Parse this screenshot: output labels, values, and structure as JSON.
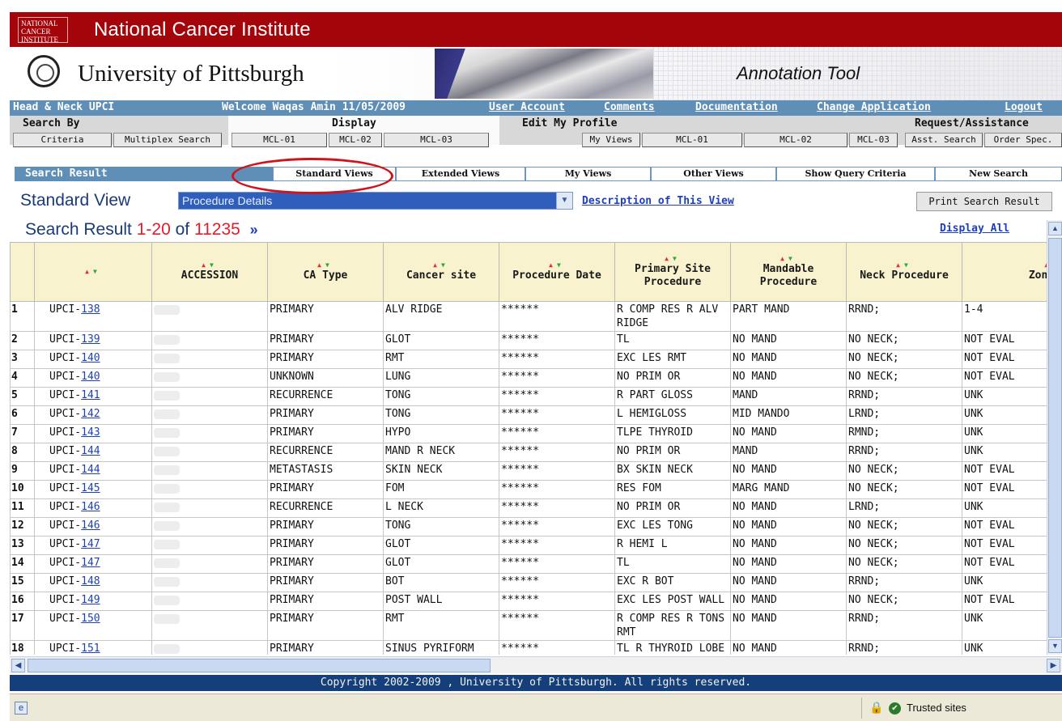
{
  "nci_banner": {
    "logo_text": "NATIONAL CANCER INSTITUTE",
    "title": "National Cancer Institute"
  },
  "pitt_header": {
    "university": "University of Pittsburgh",
    "tool_name": "Annotation Tool"
  },
  "navbar": {
    "section": "Head & Neck  UPCI",
    "welcome": "Welcome Waqas Amin 11/05/2009",
    "links": [
      "User Account",
      "Comments",
      "Documentation",
      "Change Application",
      "Logout"
    ]
  },
  "groups": {
    "search_by": {
      "label": "Search By",
      "buttons": [
        "Criteria",
        "Multiplex Search"
      ]
    },
    "display": {
      "label": "Display",
      "buttons": [
        "MCL-01",
        "MCL-02",
        "MCL-03"
      ]
    },
    "edit_profile": {
      "label": "Edit My Profile",
      "buttons": [
        "My Views",
        "MCL-01",
        "MCL-02",
        "MCL-03"
      ]
    },
    "request": {
      "label": "Request/Assistance",
      "buttons": [
        "Asst. Search",
        "Order Spec."
      ]
    }
  },
  "tabs": {
    "result_label": "Search Result",
    "items": [
      "Standard Views",
      "Extended Views",
      "My Views",
      "Other Views",
      "Show Query Criteria",
      "New Search"
    ]
  },
  "standard_view": {
    "label": "Standard View",
    "selected": "Procedure Details",
    "description_link": "Description of This View",
    "print_button": "Print Search Result"
  },
  "search_result": {
    "prefix": "Search Result",
    "range": "1-20",
    "of": "of",
    "total": "11235",
    "next_icon": "»",
    "display_all": "Display All"
  },
  "table": {
    "columns": [
      "",
      "",
      "ACCESSION",
      "CA Type",
      "Cancer site",
      "Procedure Date",
      "Primary Site Procedure",
      "Mandable Procedure",
      "Neck Procedure",
      "Zones"
    ],
    "sort_arrows": "▲▼",
    "rows": [
      {
        "n": "1",
        "prefix": "UPCI-",
        "id": "138",
        "ca": "PRIMARY",
        "site": "ALV RIDGE",
        "date": "******",
        "psp": "R COMP RES R ALV RIDGE",
        "mand": "PART MAND",
        "neck": "RRND;",
        "zones": "1-4"
      },
      {
        "n": "2",
        "prefix": "UPCI-",
        "id": "139",
        "ca": "PRIMARY",
        "site": "GLOT",
        "date": "******",
        "psp": "TL",
        "mand": "NO MAND",
        "neck": "NO NECK;",
        "zones": "NOT EVAL"
      },
      {
        "n": "3",
        "prefix": "UPCI-",
        "id": "140",
        "ca": "PRIMARY",
        "site": "RMT",
        "date": "******",
        "psp": "EXC LES RMT",
        "mand": "NO MAND",
        "neck": "NO NECK;",
        "zones": "NOT EVAL"
      },
      {
        "n": "4",
        "prefix": "UPCI-",
        "id": "140",
        "ca": "UNKNOWN",
        "site": "LUNG",
        "date": "******",
        "psp": "NO PRIM OR",
        "mand": "NO MAND",
        "neck": "NO NECK;",
        "zones": "NOT EVAL"
      },
      {
        "n": "5",
        "prefix": "UPCI-",
        "id": "141",
        "ca": "RECURRENCE",
        "site": "TONG",
        "date": "******",
        "psp": "R PART GLOSS",
        "mand": "MAND",
        "neck": "RRND;",
        "zones": "UNK"
      },
      {
        "n": "6",
        "prefix": "UPCI-",
        "id": "142",
        "ca": "PRIMARY",
        "site": "TONG",
        "date": "******",
        "psp": "L HEMIGLOSS",
        "mand": "MID MANDO",
        "neck": "LRND;",
        "zones": "UNK"
      },
      {
        "n": "7",
        "prefix": "UPCI-",
        "id": "143",
        "ca": "PRIMARY",
        "site": "HYPO",
        "date": "******",
        "psp": "TLPE THYROID",
        "mand": "NO MAND",
        "neck": "RMND;",
        "zones": "UNK"
      },
      {
        "n": "8",
        "prefix": "UPCI-",
        "id": "144",
        "ca": "RECURRENCE",
        "site": "MAND R NECK",
        "date": "******",
        "psp": "NO PRIM OR",
        "mand": "MAND",
        "neck": "RRND;",
        "zones": "UNK"
      },
      {
        "n": "9",
        "prefix": "UPCI-",
        "id": "144",
        "ca": "METASTASIS",
        "site": "SKIN NECK",
        "date": "******",
        "psp": "BX SKIN NECK",
        "mand": "NO MAND",
        "neck": "NO NECK;",
        "zones": "NOT EVAL"
      },
      {
        "n": "10",
        "prefix": "UPCI-",
        "id": "145",
        "ca": "PRIMARY",
        "site": "FOM",
        "date": "******",
        "psp": "RES FOM",
        "mand": "MARG MAND",
        "neck": "NO NECK;",
        "zones": "NOT EVAL"
      },
      {
        "n": "11",
        "prefix": "UPCI-",
        "id": "146",
        "ca": "RECURRENCE",
        "site": "L NECK",
        "date": "******",
        "psp": "NO PRIM OR",
        "mand": "NO MAND",
        "neck": "LRND;",
        "zones": "UNK"
      },
      {
        "n": "12",
        "prefix": "UPCI-",
        "id": "146",
        "ca": "PRIMARY",
        "site": "TONG",
        "date": "******",
        "psp": "EXC LES TONG",
        "mand": "NO MAND",
        "neck": "NO NECK;",
        "zones": "NOT EVAL"
      },
      {
        "n": "13",
        "prefix": "UPCI-",
        "id": "147",
        "ca": "PRIMARY",
        "site": "GLOT",
        "date": "******",
        "psp": "R HEMI L",
        "mand": "NO MAND",
        "neck": "NO NECK;",
        "zones": "NOT EVAL"
      },
      {
        "n": "14",
        "prefix": "UPCI-",
        "id": "147",
        "ca": "PRIMARY",
        "site": "GLOT",
        "date": "******",
        "psp": "TL",
        "mand": "NO MAND",
        "neck": "NO NECK;",
        "zones": "NOT EVAL"
      },
      {
        "n": "15",
        "prefix": "UPCI-",
        "id": "148",
        "ca": "PRIMARY",
        "site": "BOT",
        "date": "******",
        "psp": "EXC R BOT",
        "mand": "NO MAND",
        "neck": "RRND;",
        "zones": "UNK"
      },
      {
        "n": "16",
        "prefix": "UPCI-",
        "id": "149",
        "ca": "PRIMARY",
        "site": "POST WALL",
        "date": "******",
        "psp": "EXC LES POST WALL",
        "mand": "NO MAND",
        "neck": "NO NECK;",
        "zones": "NOT EVAL"
      },
      {
        "n": "17",
        "prefix": "UPCI-",
        "id": "150",
        "ca": "PRIMARY",
        "site": "RMT",
        "date": "******",
        "psp": "R COMP RES R TONS RMT",
        "mand": "NO MAND",
        "neck": "RRND;",
        "zones": "UNK"
      },
      {
        "n": "18",
        "prefix": "UPCI-",
        "id": "151",
        "ca": "PRIMARY",
        "site": "SINUS PYRIFORM",
        "date": "******",
        "psp": "TL R THYROID LOBE",
        "mand": "NO MAND",
        "neck": "RRND;",
        "zones": "UNK"
      }
    ]
  },
  "footer": {
    "copyright": "Copyright 2002-2009 , University of Pittsburgh. All rights reserved."
  },
  "statusbar": {
    "zone": "Trusted sites",
    "icons": [
      "ie-page-icon",
      "lock-icon",
      "trusted-check-icon"
    ]
  },
  "colors": {
    "nci_red": "#a3050a",
    "nav_blue": "#5f8fb7",
    "footer_navy": "#143f7a",
    "header_cream": "#f8f2cf",
    "highlight_red": "#d0141c"
  }
}
